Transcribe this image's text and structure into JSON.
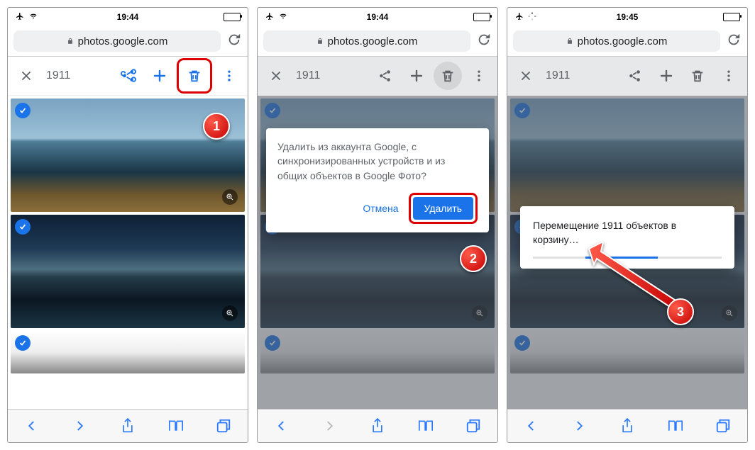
{
  "status": {
    "time_left": "19:44",
    "time_mid": "19:44",
    "time_right": "19:45"
  },
  "url": "photos.google.com",
  "selection_count": "1911",
  "popover_text": "Удалить из аккаунта Google, с синхронизированных устройств и из общих объектов в Google Фото?",
  "popover_cancel": "Отмена",
  "popover_delete": "Удалить",
  "toast_text": "Перемещение 1911 объектов в корзину…",
  "step1": "1",
  "step2": "2",
  "step3": "3"
}
